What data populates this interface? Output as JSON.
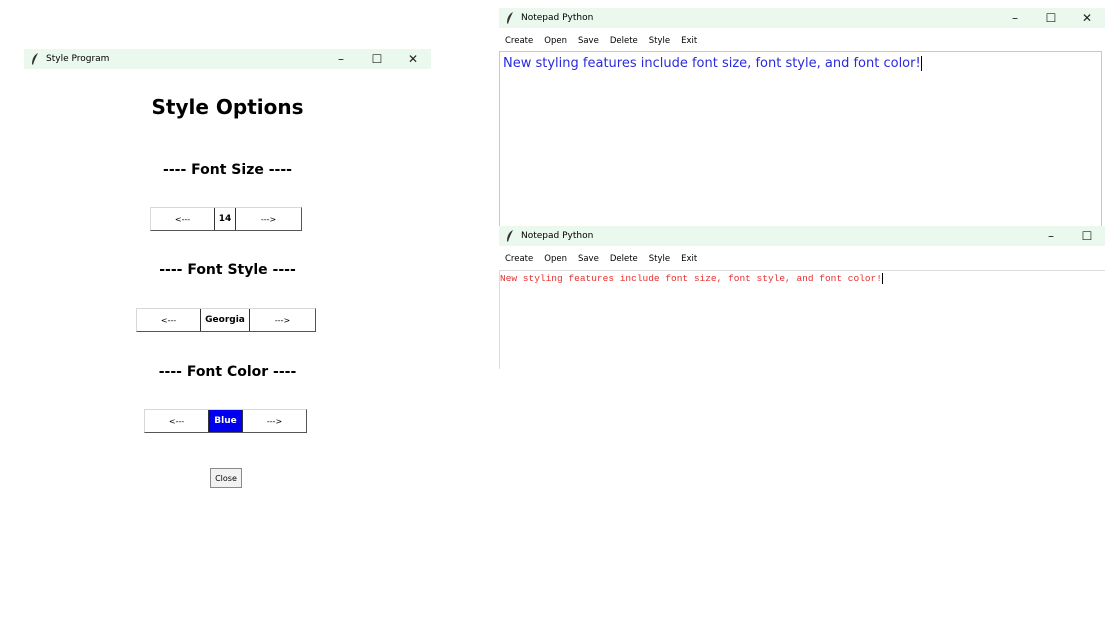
{
  "style_program": {
    "title": "Style Program",
    "heading": "Style Options",
    "font_size": {
      "label": "---- Font Size ----",
      "prev": "<---",
      "value": "14",
      "next": "--->"
    },
    "font_style": {
      "label": "---- Font Style ----",
      "prev": "<---",
      "value": "Georgia",
      "next": "--->"
    },
    "font_color": {
      "label": "---- Font Color ----",
      "prev": "<---",
      "value": "Blue",
      "next": "--->",
      "swatch": "#0000ee"
    },
    "close_label": "Close"
  },
  "notepad_top": {
    "title": "Notepad Python",
    "menu": [
      "Create",
      "Open",
      "Save",
      "Delete",
      "Style",
      "Exit"
    ],
    "text": "New styling features include font size, font style, and font color!",
    "text_color": "#2a2ae0"
  },
  "notepad_bottom": {
    "title": "Notepad Python",
    "menu": [
      "Create",
      "Open",
      "Save",
      "Delete",
      "Style",
      "Exit"
    ],
    "text": "New styling features include font size, font style, and font color!",
    "text_color": "#e53030"
  }
}
